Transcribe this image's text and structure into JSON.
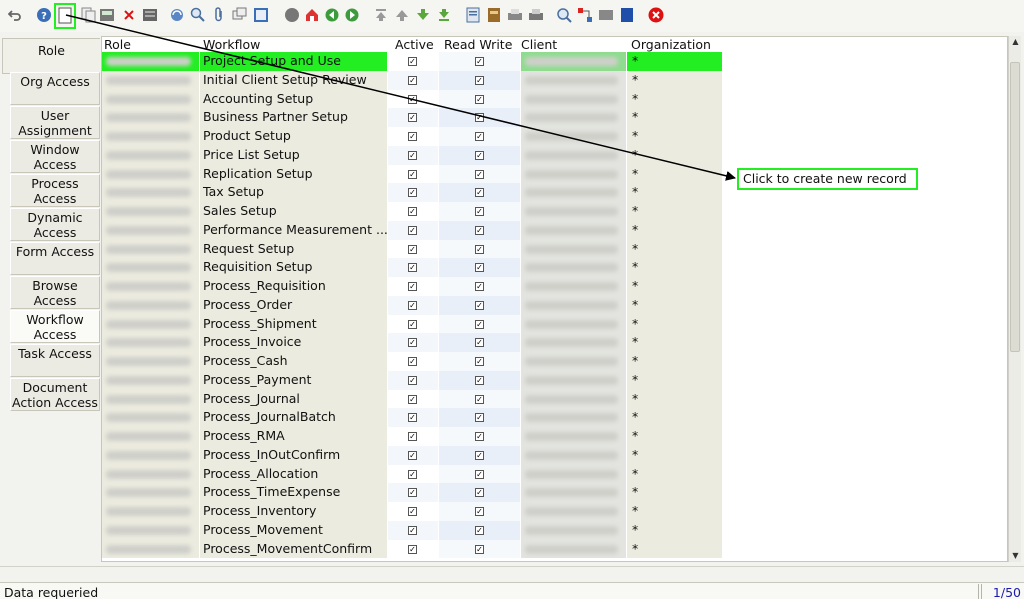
{
  "toolbar": {
    "icons": [
      "undo-icon",
      "help-icon",
      "new-record-icon",
      "copy-record-icon",
      "save-icon",
      "delete-icon",
      "delete-selection-icon",
      "refresh-icon",
      "find-icon",
      "attachment-icon",
      "chat-icon",
      "grid-toggle-icon",
      "history-icon",
      "home-icon",
      "back-icon",
      "forward-icon",
      "first-record-icon",
      "previous-record-icon",
      "next-record-icon",
      "last-record-icon",
      "report-icon",
      "archive-icon",
      "print-preview-icon",
      "print-icon",
      "zoom-across-icon",
      "workflow-icon",
      "process-icon",
      "post-icon",
      "exit-icon"
    ]
  },
  "tabs": [
    {
      "label": "Role"
    },
    {
      "label": "Org Access"
    },
    {
      "label": "User Assignment"
    },
    {
      "label": "Window Access"
    },
    {
      "label": "Process Access"
    },
    {
      "label": "Dynamic Access"
    },
    {
      "label": "Form Access"
    },
    {
      "label": "Browse Access"
    },
    {
      "label": "Workflow Access"
    },
    {
      "label": "Task Access"
    },
    {
      "label": "Document Action Access"
    }
  ],
  "grid": {
    "columns": {
      "role": "Role",
      "workflow": "Workflow",
      "active": "Active",
      "read_write": "Read Write",
      "client": "Client",
      "organization": "Organization"
    },
    "rows": [
      {
        "workflow": "Project Setup and Use",
        "active": true,
        "read_write": true,
        "org": "*"
      },
      {
        "workflow": "Initial Client Setup Review",
        "active": true,
        "read_write": true,
        "org": "*"
      },
      {
        "workflow": "Accounting Setup",
        "active": true,
        "read_write": true,
        "org": "*"
      },
      {
        "workflow": "Business Partner Setup",
        "active": true,
        "read_write": true,
        "org": "*"
      },
      {
        "workflow": "Product Setup",
        "active": true,
        "read_write": true,
        "org": "*"
      },
      {
        "workflow": "Price List Setup",
        "active": true,
        "read_write": true,
        "org": "*"
      },
      {
        "workflow": "Replication Setup",
        "active": true,
        "read_write": true,
        "org": "*"
      },
      {
        "workflow": "Tax Setup",
        "active": true,
        "read_write": true,
        "org": "*"
      },
      {
        "workflow": "Sales Setup",
        "active": true,
        "read_write": true,
        "org": "*"
      },
      {
        "workflow": "Performance Measurement ...",
        "active": true,
        "read_write": true,
        "org": "*"
      },
      {
        "workflow": "Request Setup",
        "active": true,
        "read_write": true,
        "org": "*"
      },
      {
        "workflow": "Requisition Setup",
        "active": true,
        "read_write": true,
        "org": "*"
      },
      {
        "workflow": "Process_Requisition",
        "active": true,
        "read_write": true,
        "org": "*"
      },
      {
        "workflow": "Process_Order",
        "active": true,
        "read_write": true,
        "org": "*"
      },
      {
        "workflow": "Process_Shipment",
        "active": true,
        "read_write": true,
        "org": "*"
      },
      {
        "workflow": "Process_Invoice",
        "active": true,
        "read_write": true,
        "org": "*"
      },
      {
        "workflow": "Process_Cash",
        "active": true,
        "read_write": true,
        "org": "*"
      },
      {
        "workflow": "Process_Payment",
        "active": true,
        "read_write": true,
        "org": "*"
      },
      {
        "workflow": "Process_Journal",
        "active": true,
        "read_write": true,
        "org": "*"
      },
      {
        "workflow": "Process_JournalBatch",
        "active": true,
        "read_write": true,
        "org": "*"
      },
      {
        "workflow": "Process_RMA",
        "active": true,
        "read_write": true,
        "org": "*"
      },
      {
        "workflow": "Process_InOutConfirm",
        "active": true,
        "read_write": true,
        "org": "*"
      },
      {
        "workflow": "Process_Allocation",
        "active": true,
        "read_write": true,
        "org": "*"
      },
      {
        "workflow": "Process_TimeExpense",
        "active": true,
        "read_write": true,
        "org": "*"
      },
      {
        "workflow": "Process_Inventory",
        "active": true,
        "read_write": true,
        "org": "*"
      },
      {
        "workflow": "Process_Movement",
        "active": true,
        "read_write": true,
        "org": "*"
      },
      {
        "workflow": "Process_MovementConfirm",
        "active": true,
        "read_write": true,
        "org": "*"
      }
    ],
    "selected_row": 0
  },
  "annotation": {
    "callout_text": "Click to create new record",
    "highlight_color": "#22ee22"
  },
  "status": {
    "message": "Data requeried",
    "record_count": "1/50"
  },
  "colors": {
    "selected_row": "#22ee22",
    "record_count": "#1a1ab0",
    "delete": "#dd1111"
  }
}
